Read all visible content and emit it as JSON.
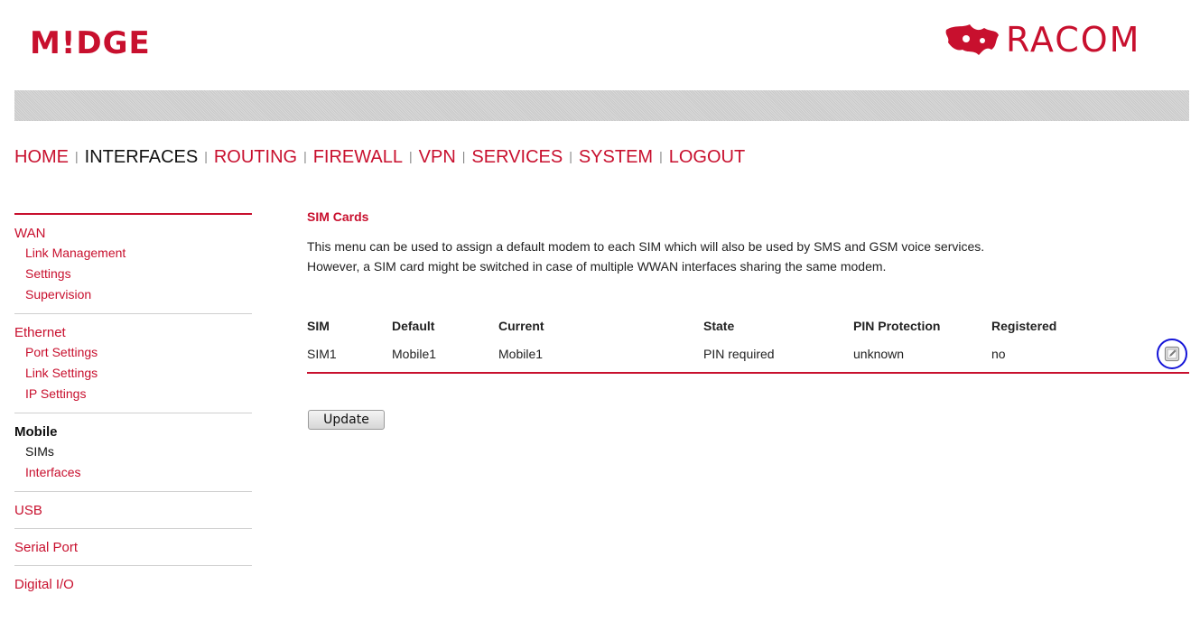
{
  "header": {
    "left_logo": "M!DGE",
    "right_logo": "RACOM",
    "brand_color": "#c8102e"
  },
  "topnav": {
    "items": [
      {
        "label": "HOME",
        "active": false
      },
      {
        "label": "INTERFACES",
        "active": true
      },
      {
        "label": "ROUTING",
        "active": false
      },
      {
        "label": "FIREWALL",
        "active": false
      },
      {
        "label": "VPN",
        "active": false
      },
      {
        "label": "SERVICES",
        "active": false
      },
      {
        "label": "SYSTEM",
        "active": false
      },
      {
        "label": "LOGOUT",
        "active": false
      }
    ],
    "separator": "|"
  },
  "sidebar": {
    "groups": [
      {
        "label": "WAN",
        "items": [
          "Link Management",
          "Settings",
          "Supervision"
        ]
      },
      {
        "label": "Ethernet",
        "items": [
          "Port Settings",
          "Link Settings",
          "IP Settings"
        ]
      },
      {
        "label": "Mobile",
        "items": [
          "SIMs",
          "Interfaces"
        ]
      },
      {
        "label": "USB",
        "items": []
      },
      {
        "label": "Serial Port",
        "items": []
      },
      {
        "label": "Digital I/O",
        "items": []
      }
    ]
  },
  "main": {
    "title": "SIM Cards",
    "desc_line1": "This menu can be used to assign a default modem to each SIM which will also be used by SMS and GSM voice services.",
    "desc_line2": "However, a SIM card might be switched in case of multiple WWAN interfaces sharing the same modem.",
    "table": {
      "headers": [
        "SIM",
        "Default",
        "Current",
        "State",
        "PIN Protection",
        "Registered"
      ],
      "rows": [
        [
          "SIM1",
          "Mobile1",
          "Mobile1",
          "PIN required",
          "unknown",
          "no"
        ]
      ]
    },
    "edit_icon": "edit-icon",
    "update_label": "Update"
  }
}
